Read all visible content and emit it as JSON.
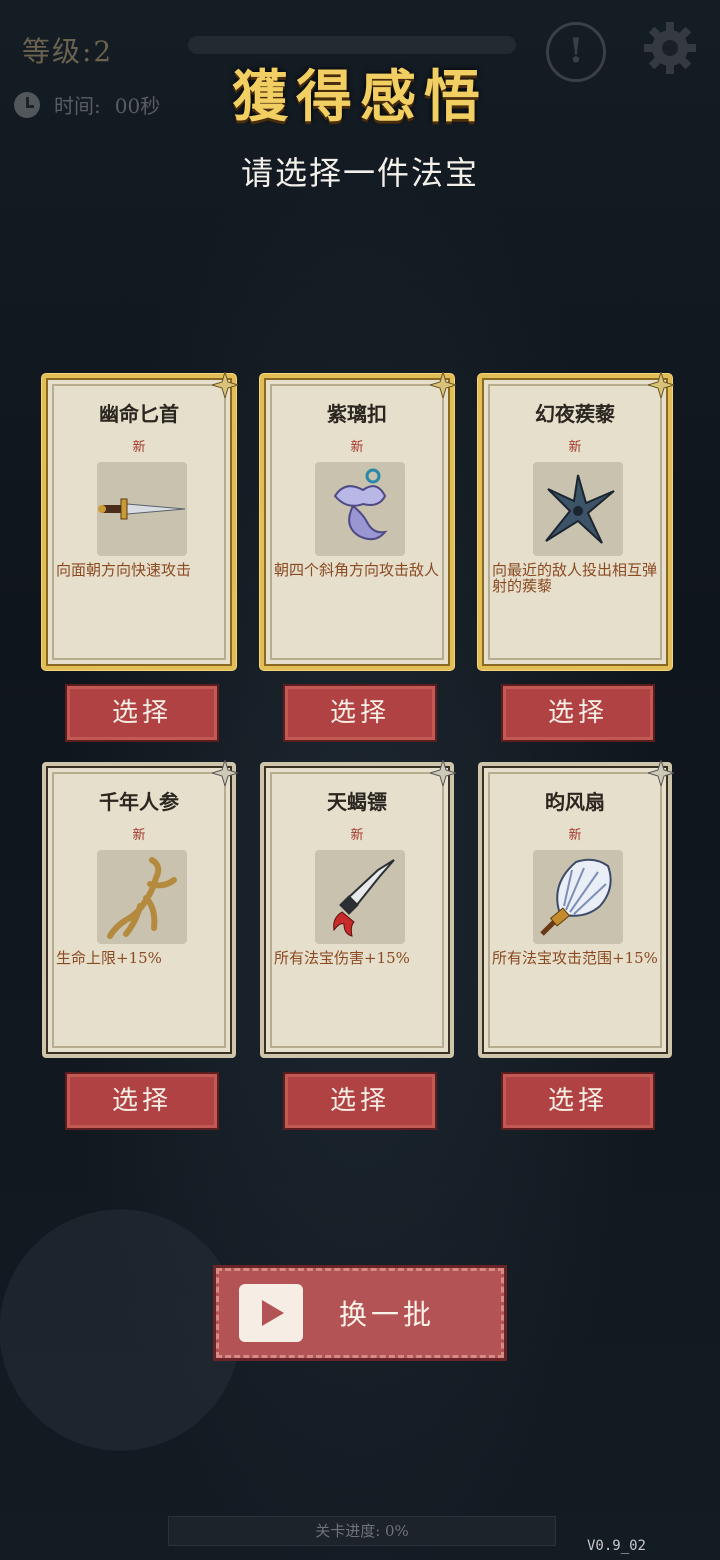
{
  "hud": {
    "level": "等级:2",
    "time_label": "时间:",
    "time_value": "00秒",
    "alert_icon": "exclamation-icon",
    "settings_icon": "gear-icon"
  },
  "header": {
    "title": "獲得感悟",
    "subtitle": "请选择一件法宝"
  },
  "cards": [
    {
      "name": "幽命匕首",
      "tag": "新",
      "desc": "向面朝方向快速攻击",
      "icon": "dagger-icon",
      "rarity": "gold",
      "button": "选择"
    },
    {
      "name": "紫璃扣",
      "tag": "新",
      "desc": "朝四个斜角方向攻击敌人",
      "icon": "purple-charm-icon",
      "rarity": "gold",
      "button": "选择"
    },
    {
      "name": "幻夜蒺藜",
      "tag": "新",
      "desc": "向最近的敌人投出相互弹射的蒺藜",
      "icon": "shuriken-icon",
      "rarity": "gold",
      "button": "选择"
    },
    {
      "name": "千年人参",
      "tag": "新",
      "desc": "生命上限+15%",
      "icon": "ginseng-icon",
      "rarity": "normal",
      "button": "选择"
    },
    {
      "name": "天蝎镖",
      "tag": "新",
      "desc": "所有法宝伤害+15%",
      "icon": "dart-icon",
      "rarity": "normal",
      "button": "选择"
    },
    {
      "name": "昀风扇",
      "tag": "新",
      "desc": "所有法宝攻击范围+15%",
      "icon": "feather-fan-icon",
      "rarity": "normal",
      "button": "选择"
    }
  ],
  "refresh": {
    "label": "换一批",
    "icon": "video-play-icon"
  },
  "footer": {
    "progress": "关卡进度: 0%",
    "version": "V0.9_02"
  }
}
